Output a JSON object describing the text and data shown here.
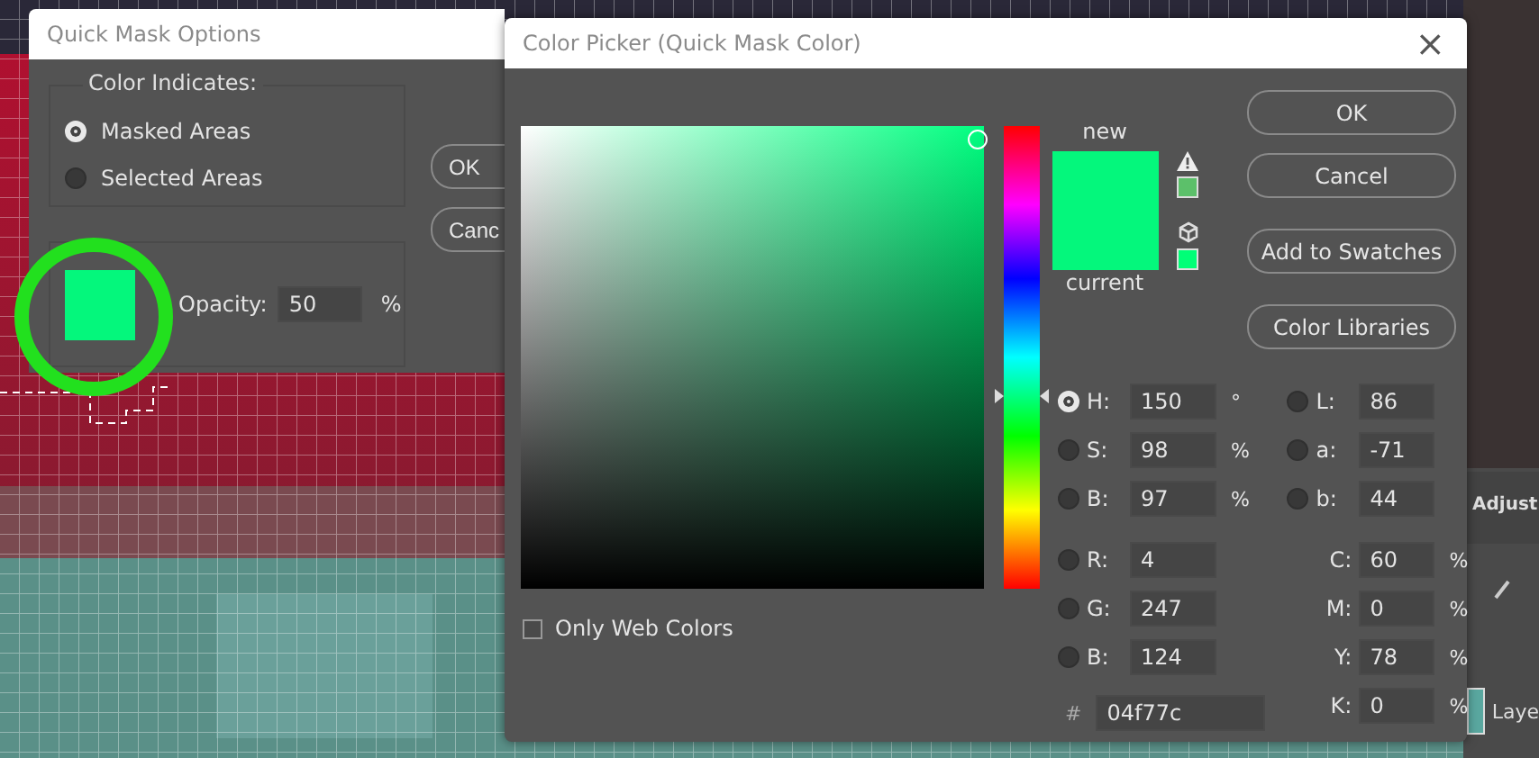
{
  "quick_mask_dialog": {
    "title": "Quick Mask Options",
    "color_indicates": {
      "label": "Color Indicates:",
      "options": [
        {
          "label": "Masked Areas",
          "selected": true
        },
        {
          "label": "Selected Areas",
          "selected": false
        }
      ]
    },
    "buttons": [
      "OK",
      "Canc"
    ],
    "color": {
      "opacity_label": "Opacity:",
      "opacity": "50",
      "unit": "%"
    }
  },
  "color_picker": {
    "title": "Color Picker (Quick Mask Color)",
    "close": "×",
    "new_label": "new",
    "current_label": "current",
    "hue_slider": {
      "level": 0.417
    },
    "buttons": [
      "OK",
      "Cancel",
      "Add to Swatches",
      "Color Libraries"
    ],
    "only_web_colors": {
      "label": "Only Web Colors",
      "checked": false
    },
    "hsb": [
      {
        "label": "H:",
        "value": "150",
        "unit": "°",
        "selected": true
      },
      {
        "label": "S:",
        "value": "98",
        "unit": "%",
        "selected": false
      },
      {
        "label": "B:",
        "value": "97",
        "unit": "%",
        "selected": false
      }
    ],
    "lab": [
      {
        "label": "L:",
        "value": "86",
        "selected": false
      },
      {
        "label": "a:",
        "value": "-71",
        "selected": false
      },
      {
        "label": "b:",
        "value": "44",
        "selected": false
      }
    ],
    "rgb": [
      {
        "label": "R:",
        "value": "4",
        "selected": false
      },
      {
        "label": "G:",
        "value": "247",
        "selected": false
      },
      {
        "label": "B:",
        "value": "124",
        "selected": false
      }
    ],
    "cmyk": [
      {
        "label": "C:",
        "value": "60",
        "unit": "%"
      },
      {
        "label": "M:",
        "value": "0",
        "unit": "%"
      },
      {
        "label": "Y:",
        "value": "78",
        "unit": "%"
      },
      {
        "label": "K:",
        "value": "0",
        "unit": "%"
      }
    ],
    "hex_label": "#",
    "hex": "04f77c"
  },
  "side_panel": {
    "adjustments_tab": "Adjust",
    "layer_label": "Laye"
  }
}
